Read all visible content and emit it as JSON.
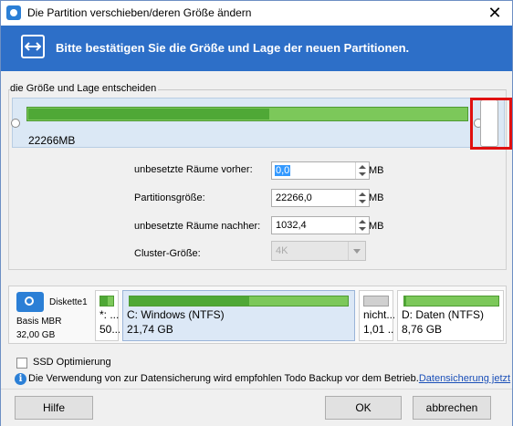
{
  "window": {
    "title": "Die Partition verschieben/deren Größe ändern",
    "close_glyph": "✕"
  },
  "banner": {
    "icon": "resize-arrows-icon",
    "text": "Bitte bestätigen Sie die Größe und Lage der neuen Partitionen.",
    "color": "#2d6fc8"
  },
  "size_group": {
    "label": "die Größe und Lage entscheiden",
    "partition_size_display": "22266MB",
    "used_fraction": 0.55
  },
  "fields": {
    "unalloc_before": {
      "label": "unbesetzte Räume vorher:",
      "value": "0,0",
      "unit": "MB"
    },
    "partition_size": {
      "label": "Partitionsgröße:",
      "value": "22266,0",
      "unit": "MB"
    },
    "unalloc_after": {
      "label": "unbesetzte Räume nachher:",
      "value": "1032,4",
      "unit": "MB"
    },
    "cluster_size": {
      "label": "Cluster-Größe:",
      "value": "4K"
    }
  },
  "disk": {
    "name": "Diskette1",
    "type": "Basis MBR",
    "size": "32,00 GB",
    "partitions": [
      {
        "line1": "*: ...",
        "line2": "50...",
        "used_fraction": 0.6,
        "color": "#7cc85a"
      },
      {
        "line1": "C: Windows (NTFS)",
        "line2": "21,74 GB",
        "used_fraction": 0.55,
        "color": "#7cc85a"
      },
      {
        "line1": "nicht...",
        "line2": "1,01 ...",
        "used_fraction": 0,
        "color": "#d0d0d0"
      },
      {
        "line1": "D: Daten (NTFS)",
        "line2": "8,76 GB",
        "used_fraction": 0.02,
        "color": "#7cc85a"
      }
    ]
  },
  "options": {
    "ssd_label": "SSD Optimierung",
    "ssd_checked": false
  },
  "info": {
    "icon": "info-icon",
    "text": "Die Verwendung von zur Datensicherung wird empfohlen Todo Backup vor dem Betrieb.",
    "link": "Datensicherung jetzt"
  },
  "footer": {
    "help": "Hilfe",
    "ok": "OK",
    "cancel": "abbrechen"
  }
}
